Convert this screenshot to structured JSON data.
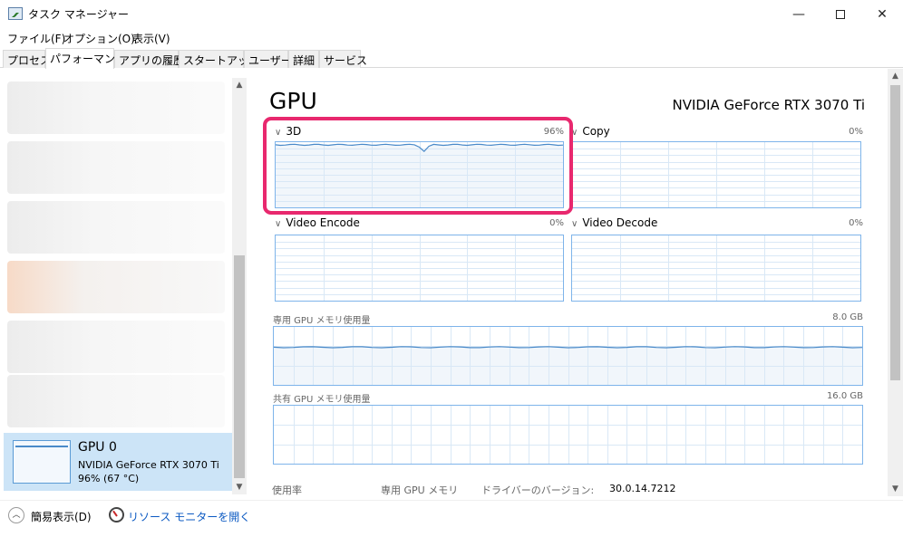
{
  "window": {
    "title": "タスク マネージャー",
    "minimize_glyph": "—",
    "close_glyph": "✕"
  },
  "menu": [
    "ファイル(F)",
    "オプション(O)",
    "表示(V)"
  ],
  "tabs": [
    {
      "label": "プロセス",
      "active": false
    },
    {
      "label": "パフォーマンス",
      "active": true
    },
    {
      "label": "アプリの履歴",
      "active": false
    },
    {
      "label": "スタートアップ",
      "active": false
    },
    {
      "label": "ユーザー",
      "active": false
    },
    {
      "label": "詳細",
      "active": false
    },
    {
      "label": "サービス",
      "active": false
    }
  ],
  "sidebar": {
    "selected": {
      "title": "GPU 0",
      "subtitle": "NVIDIA GeForce RTX 3070 Ti",
      "stats": "96%  (67 °C)"
    }
  },
  "main": {
    "title": "GPU",
    "model": "NVIDIA GeForce RTX 3070 Ti",
    "engines": [
      {
        "label": "3D",
        "percent": "96%",
        "usage": 0.96
      },
      {
        "label": "Copy",
        "percent": "0%",
        "usage": 0
      },
      {
        "label": "Video Encode",
        "percent": "0%",
        "usage": 0
      },
      {
        "label": "Video Decode",
        "percent": "0%",
        "usage": 0
      }
    ],
    "dedicated_memory": {
      "label": "専用 GPU メモリ使用量",
      "max": "8.0 GB"
    },
    "shared_memory": {
      "label": "共有 GPU メモリ使用量",
      "max": "16.0 GB"
    },
    "stats": [
      {
        "label": "使用率"
      },
      {
        "label": "専用 GPU メモリ"
      },
      {
        "label": "ドライバーのバージョン:",
        "value": "30.0.14.7212"
      }
    ]
  },
  "footer": {
    "less_details": "簡易表示(D)",
    "resource_monitor": "リソース モニターを開く"
  },
  "colors": {
    "graph_line": "#4a8ac9",
    "graph_fill": "#f1f6fb",
    "graph_border": "#7eb4ea",
    "highlight": "#e8286e",
    "selection": "#cce4f7",
    "link": "#0b59c2"
  }
}
